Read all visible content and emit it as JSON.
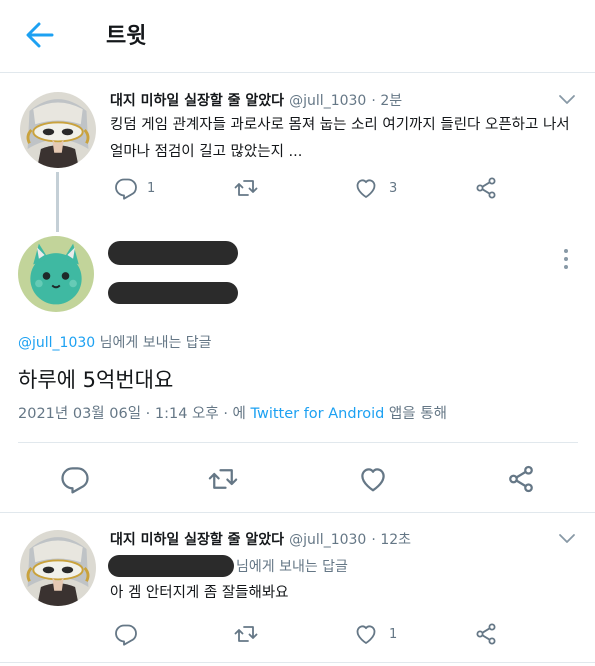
{
  "header": {
    "title": "트윗"
  },
  "tweet1": {
    "name": "대지 미하일 실장할 줄 알았다",
    "handle": "@jull_1030",
    "time": "· 2분",
    "text_line1": "킹덤 게임 관계자들 과로사로 몸져 눕는 소리 여기까지 들린다 오픈하고 나서",
    "text_line2": "얼마나 점검이 길고 많았는지 ...",
    "reply_count": "1",
    "like_count": "3"
  },
  "main_tweet": {
    "replying_handle": "@jull_1030",
    "replying_suffix": " 님에게 보내는 답글",
    "text": "하루에 5억번대요",
    "timestamp_prefix": "2021년 03월 06일 · 1:14 오후 · 에 ",
    "source": "Twitter for Android",
    "timestamp_suffix": " 앱을 통해"
  },
  "tweet3": {
    "name": "대지 미하일 실장할 줄 알았다",
    "handle": "@jull_1030",
    "time": "· 12초",
    "replying_suffix": "님에게 보내는 답글",
    "text": "아 겜 안터지게 좀 잘들해봐요",
    "like_count": "1"
  },
  "colors": {
    "accent": "#1da1f2",
    "secondary_text": "#657786",
    "border": "#e1e8ed",
    "redaction": "#2b2b2b"
  },
  "icons": [
    "back-arrow-icon",
    "chevron-down-icon",
    "reply-icon",
    "retweet-icon",
    "like-icon",
    "share-icon",
    "more-vertical-icon"
  ]
}
